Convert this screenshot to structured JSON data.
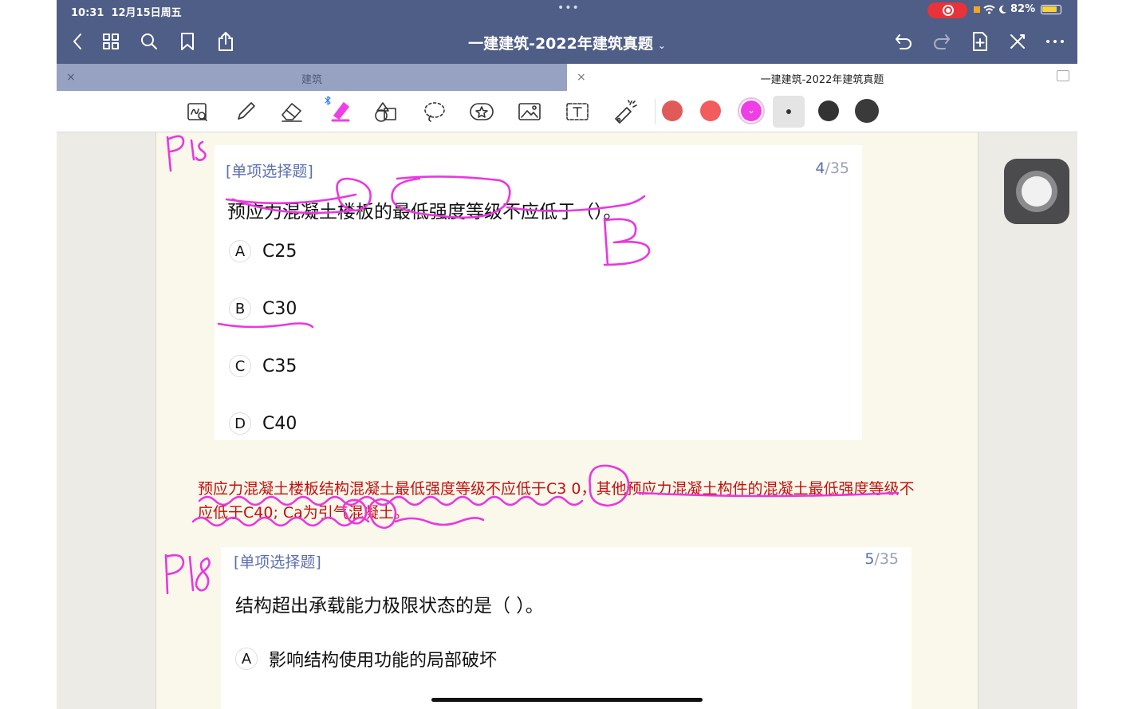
{
  "status_bar": {
    "time": "10:31",
    "date": "12月15日周五",
    "battery": "82%",
    "dots": "•••"
  },
  "nav": {
    "title": "一建建筑-2022年建筑真题",
    "title_chevron": "⌄"
  },
  "tabs": [
    {
      "label": "建筑",
      "close": "×",
      "active": false
    },
    {
      "label": "一建建筑-2022年建筑真题",
      "close": "×",
      "active": true
    }
  ],
  "toolbar": {
    "colors": [
      "#e05a5a",
      "#f25c5c",
      "#ef3ee6",
      "#333333",
      "#3a3a3a"
    ],
    "selected_color": "#ef3ee6",
    "selected_check": "⌄"
  },
  "q1": {
    "type": "[单项选择题]",
    "num_current": "4",
    "num_total": "/35",
    "text": "预应力混凝土楼板的最低强度等级不应低于（）。",
    "options": [
      {
        "letter": "A",
        "text": "C25"
      },
      {
        "letter": "B",
        "text": "C30"
      },
      {
        "letter": "C",
        "text": "C35"
      },
      {
        "letter": "D",
        "text": "C40"
      }
    ]
  },
  "explanation": "预应力混凝土楼板结构混凝土最低强度等级不应低于C3 0，其他预应力混凝土构件的混凝土最低强度等级不应低于C40; Ca为引气混凝土。",
  "q2": {
    "type": "[单项选择题]",
    "num_current": "5",
    "num_total": "/35",
    "text": "结构超出承载能力极限状态的是（ ）。",
    "options": [
      {
        "letter": "A",
        "text": "影响结构使用功能的局部破坏"
      }
    ]
  },
  "annotation_color": "#ea37e0"
}
